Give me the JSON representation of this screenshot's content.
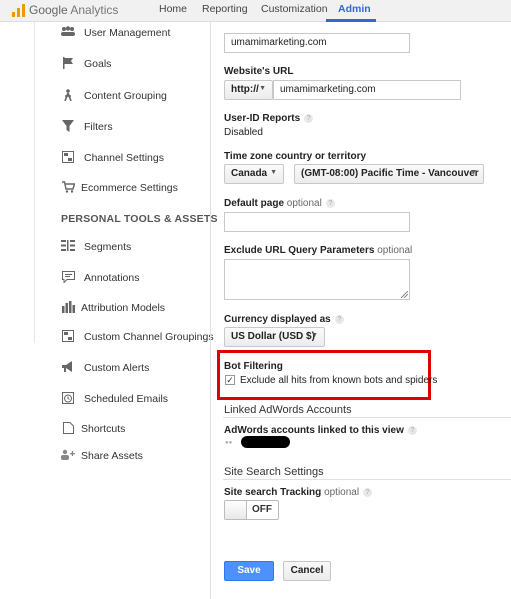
{
  "header": {
    "brand": "Google",
    "product": "Analytics",
    "nav": [
      "Home",
      "Reporting",
      "Customization",
      "Admin"
    ],
    "active_nav": "Admin"
  },
  "sidebar": {
    "items_top": [
      {
        "label": "User Management",
        "icon": "users-icon"
      },
      {
        "label": "Goals",
        "icon": "flag-icon"
      },
      {
        "label": "Content Grouping",
        "icon": "person-walk-icon"
      },
      {
        "label": "Filters",
        "icon": "filter-icon"
      },
      {
        "label": "Channel Settings",
        "icon": "channel-icon"
      },
      {
        "label": "Ecommerce Settings",
        "icon": "cart-icon"
      }
    ],
    "section_heading": "PERSONAL TOOLS & ASSETS",
    "items_bottom": [
      {
        "label": "Segments",
        "icon": "segments-icon"
      },
      {
        "label": "Annotations",
        "icon": "annotation-icon"
      },
      {
        "label": "Attribution Models",
        "icon": "bar-chart-icon"
      },
      {
        "label": "Custom Channel Groupings",
        "icon": "channel-icon"
      },
      {
        "label": "Custom Alerts",
        "icon": "megaphone-icon"
      },
      {
        "label": "Scheduled Emails",
        "icon": "clock-icon"
      },
      {
        "label": "Shortcuts",
        "icon": "document-icon"
      },
      {
        "label": "Share Assets",
        "icon": "add-user-icon"
      }
    ]
  },
  "form": {
    "property_name_value": "umamimarketing.com",
    "website_url_label": "Website's URL",
    "protocol_value": "http://",
    "website_url_value": "umamimarketing.com",
    "user_id_label": "User-ID Reports",
    "user_id_status": "Disabled",
    "timezone_label": "Time zone country or territory",
    "country_value": "Canada",
    "timezone_value": "(GMT-08:00) Pacific Time - Vancouver",
    "default_page_label": "Default page",
    "optional": "optional",
    "exclude_params_label": "Exclude URL Query Parameters",
    "currency_label": "Currency displayed as",
    "currency_value": "US Dollar (USD $)",
    "bot_filtering_label": "Bot Filtering",
    "bot_filtering_checkbox": "Exclude all hits from known bots and spiders",
    "bot_filtering_checked": true,
    "adwords_section": "Linked AdWords Accounts",
    "adwords_label": "AdWords accounts linked to this view",
    "site_search_section": "Site Search Settings",
    "site_search_label": "Site search Tracking",
    "site_search_state": "OFF",
    "save_label": "Save",
    "cancel_label": "Cancel"
  },
  "colors": {
    "accent": "#3367d6",
    "save_button": "#4d90fe",
    "highlight_box": "#e00000",
    "logo": "#f29900"
  }
}
